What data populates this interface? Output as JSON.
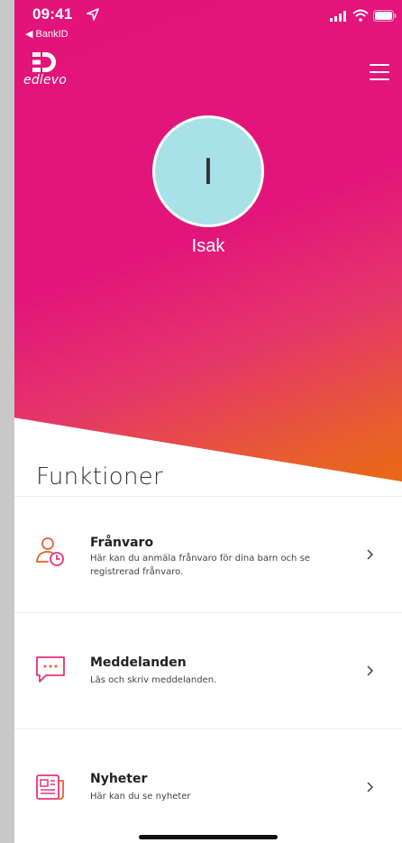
{
  "status_bar": {
    "time": "09:41",
    "back_app": "◀ BankID",
    "icons": [
      "location-arrow-icon",
      "cellular-signal-icon",
      "wifi-icon",
      "battery-icon"
    ]
  },
  "header": {
    "logo_text": "edlevo",
    "menu_icon": "hamburger-menu-icon"
  },
  "profile": {
    "initial": "I",
    "name": "Isak"
  },
  "colors": {
    "gradient_start": "#e2147a",
    "gradient_end": "#e96a10",
    "avatar_bg": "#a8e1e8",
    "icon_accent": "#e8602a"
  },
  "functions": {
    "title": "Funktioner",
    "items": [
      {
        "icon": "person-clock-icon",
        "title": "Frånvaro",
        "description": "Här kan du anmäla frånvaro för dina barn och se registrerad frånvaro."
      },
      {
        "icon": "chat-bubble-icon",
        "title": "Meddelanden",
        "description": "Läs och skriv meddelanden."
      },
      {
        "icon": "newspaper-icon",
        "title": "Nyheter",
        "description": "Här kan du se nyheter"
      }
    ]
  }
}
